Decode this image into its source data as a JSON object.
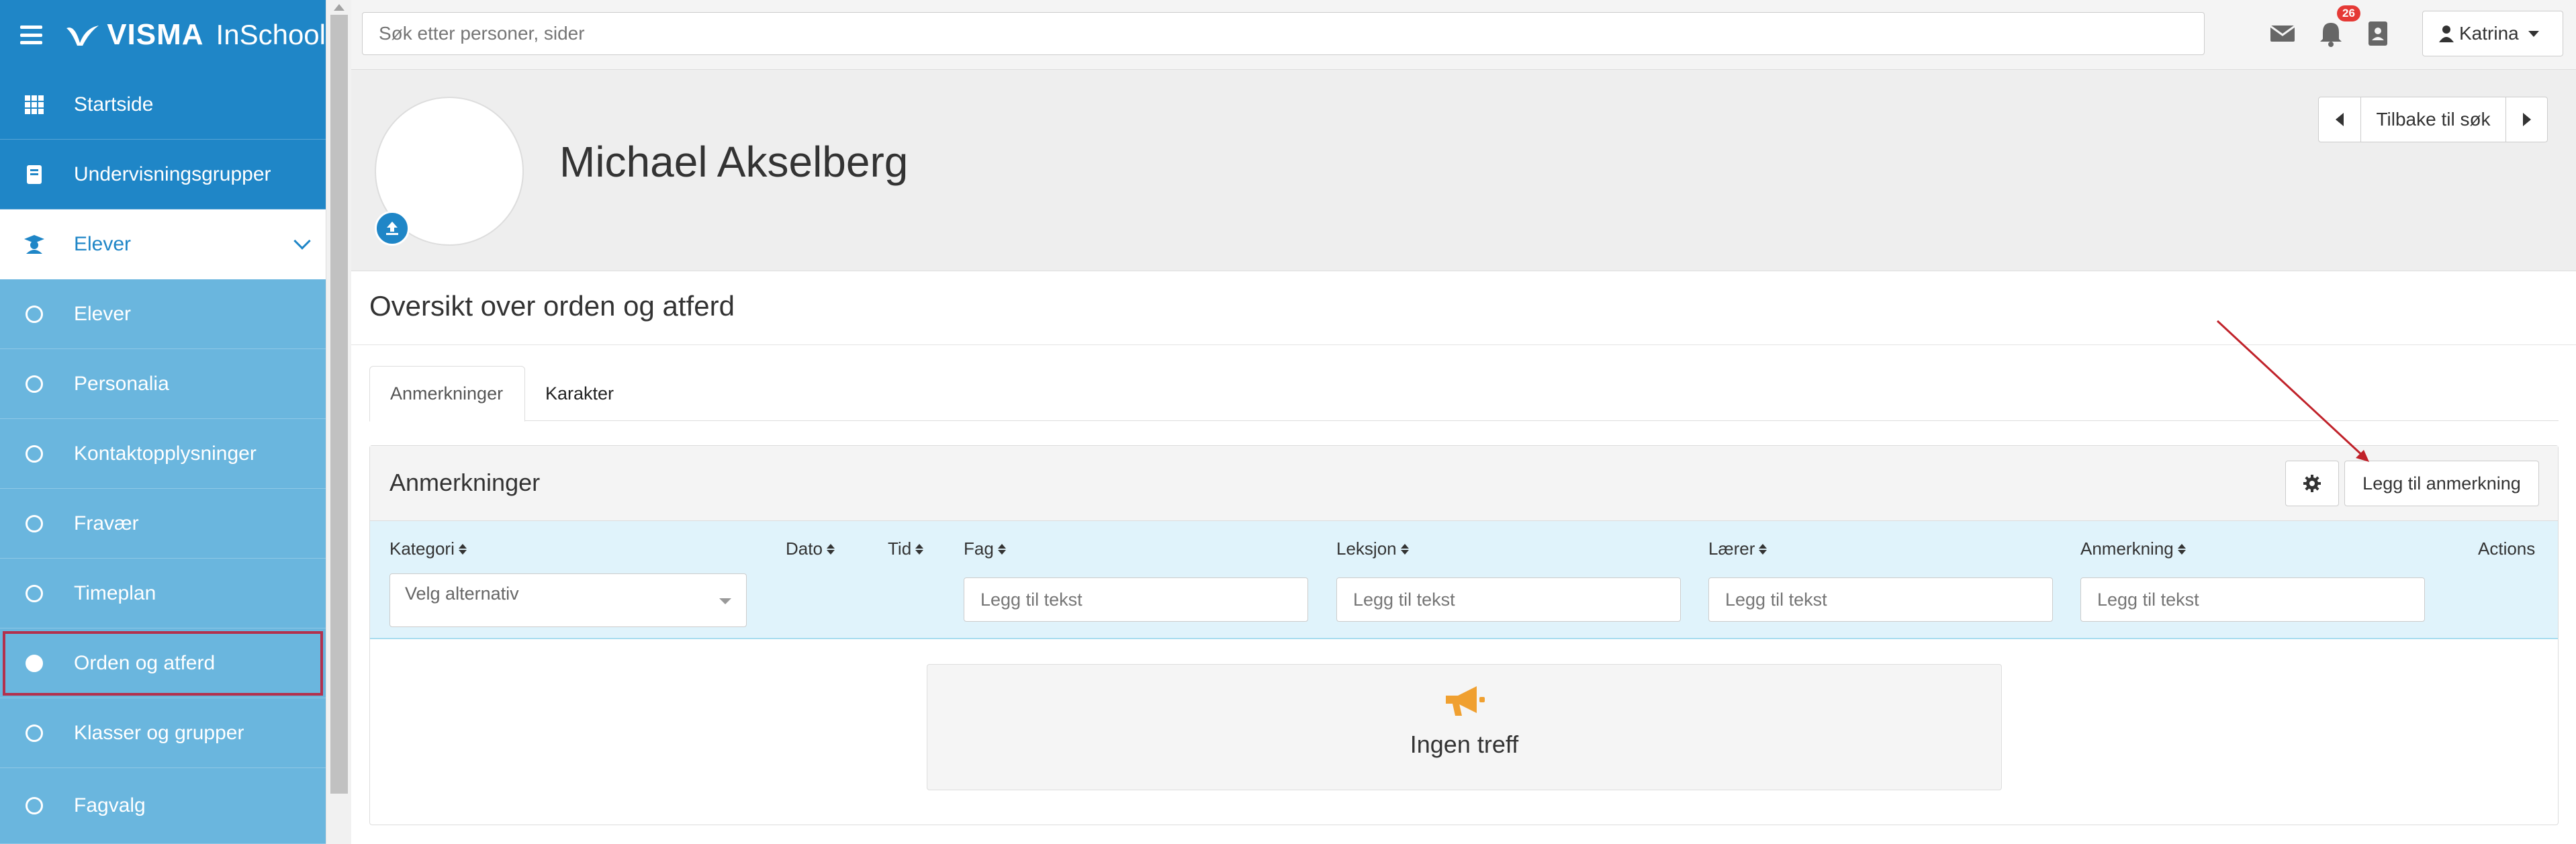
{
  "app": {
    "brand_name": "VISMA",
    "product_name": "InSchool",
    "accent_color": "#1f86c7"
  },
  "sidebar": {
    "items": [
      {
        "label": "Startside",
        "icon": "grid-icon"
      },
      {
        "label": "Undervisningsgrupper",
        "icon": "book-icon"
      },
      {
        "label": "Elever",
        "icon": "student-icon",
        "expanded": true
      },
      {
        "label": "Elever",
        "icon": "circle-icon"
      },
      {
        "label": "Personalia",
        "icon": "circle-icon"
      },
      {
        "label": "Kontaktopplysninger",
        "icon": "circle-icon"
      },
      {
        "label": "Fravær",
        "icon": "circle-icon"
      },
      {
        "label": "Timeplan",
        "icon": "circle-icon"
      },
      {
        "label": "Orden og atferd",
        "icon": "filled-circle-icon",
        "selected": true
      },
      {
        "label": "Klasser og grupper",
        "icon": "circle-icon"
      },
      {
        "label": "Fagvalg",
        "icon": "circle-icon"
      }
    ]
  },
  "topbar": {
    "search_placeholder": "Søk etter personer, sider",
    "notification_count": "26",
    "user_name": "Katrina"
  },
  "profile": {
    "name": "Michael Akselberg",
    "back_label": "Tilbake til søk"
  },
  "page": {
    "title": "Oversikt over orden og atferd",
    "tabs": [
      "Anmerkninger",
      "Karakter"
    ]
  },
  "panel": {
    "title": "Anmerkninger",
    "add_button": "Legg til anmerkning",
    "columns": [
      "Kategori",
      "Dato",
      "Tid",
      "Fag",
      "Leksjon",
      "Lærer",
      "Anmerkning",
      "Actions"
    ],
    "select_placeholder": "Velg alternativ",
    "text_placeholder": "Legg til tekst",
    "empty_text": "Ingen treff"
  }
}
